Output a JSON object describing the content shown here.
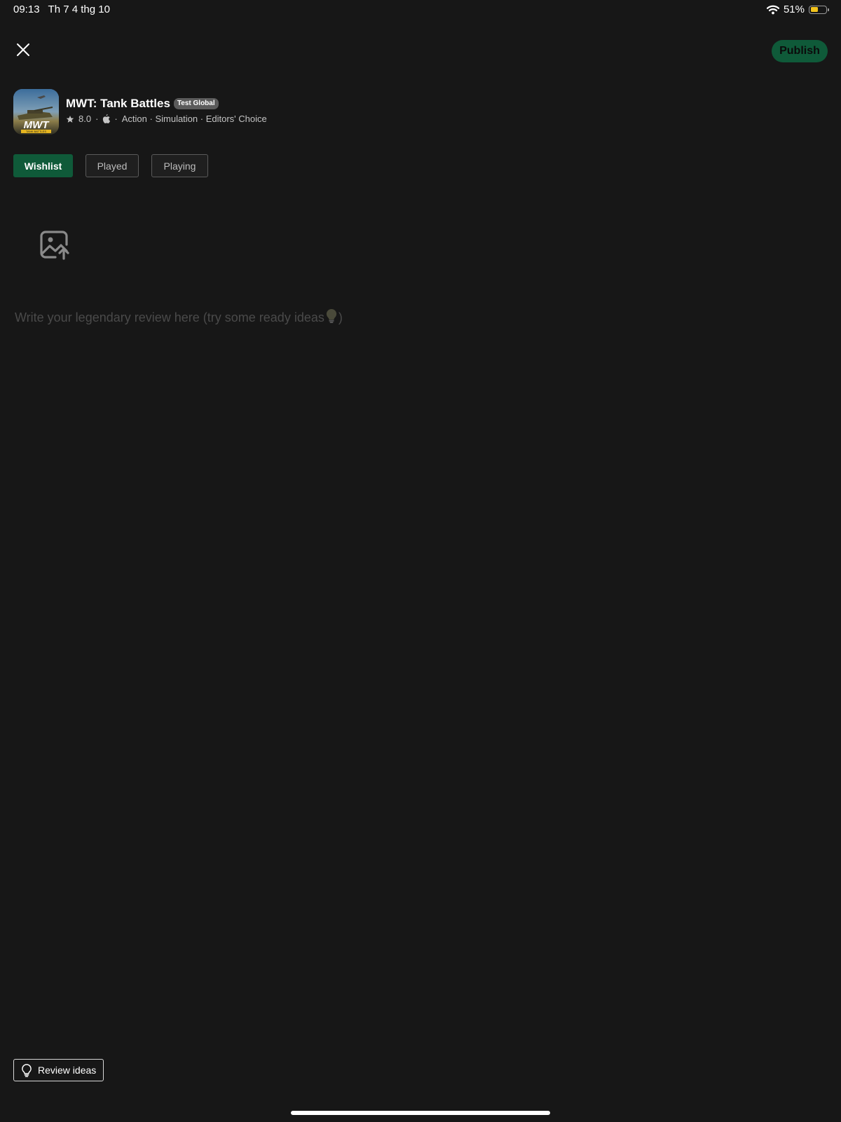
{
  "status_bar": {
    "time": "09:13",
    "date": "Th 7 4 thg 10",
    "battery_percent": "51%",
    "battery_level": 0.51,
    "battery_color": "#f2c31c",
    "icons": [
      "wifi-icon",
      "battery-icon"
    ]
  },
  "toolbar": {
    "close_icon": "close-icon",
    "publish_label": "Publish",
    "accent": "#0f5a39"
  },
  "game": {
    "title": "MWT: Tank Battles",
    "badge": "Test Global",
    "rating": "8.0",
    "platform_icon": "apple-icon",
    "genres": "Action · Simulation · Editors' Choice",
    "sep": "·",
    "icon_logo_text": "MWT",
    "icon_sub_text": "TANK BATTLES"
  },
  "status_tags": {
    "wishlist": "Wishlist",
    "played": "Played",
    "playing": "Playing",
    "active": "wishlist"
  },
  "review": {
    "upload_icon": "image-upload-icon",
    "placeholder_text": "Write your legendary review here (try some ready ideas",
    "placeholder_end": ")"
  },
  "footer": {
    "review_ideas_label": "Review ideas",
    "icon": "lightbulb-icon"
  }
}
